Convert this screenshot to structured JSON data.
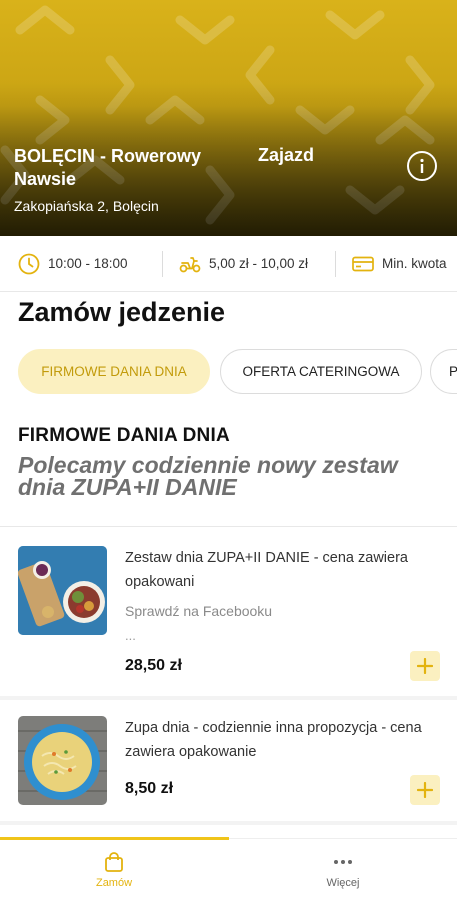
{
  "restaurant": {
    "name": "BOLĘCIN - Rowerowy Nawsie",
    "type": "Zajazd",
    "address": "Zakopiańska 2, Bolęcin"
  },
  "info_bar": {
    "hours": "10:00 - 18:00",
    "delivery_cost": "5,00 zł - 10,00 zł",
    "min_order": "Min. kwota"
  },
  "page_title": "Zamów jedzenie",
  "tabs": [
    {
      "label": "FIRMOWE DANIA DNIA",
      "active": true
    },
    {
      "label": "OFERTA CATERINGOWA",
      "active": false
    },
    {
      "label": "P",
      "active": false
    }
  ],
  "category": {
    "title": "FIRMOWE DANIA DNIA",
    "description": "Polecamy codziennie nowy zestaw dnia ZUPA+II DANIE"
  },
  "items": [
    {
      "name": "Zestaw dnia ZUPA+II DANIE - cena zawiera opakowani",
      "extra": "Sprawdź na Facebooku",
      "ellipsis": "...",
      "price": "28,50 zł"
    },
    {
      "name": "Zupa dnia - codziennie inna propozycja - cena zawiera opakowanie",
      "price": "8,50 zł"
    }
  ],
  "bottom_nav": {
    "order_label": "Zamów",
    "more_label": "Więcej"
  },
  "colors": {
    "accent": "#f0c419",
    "accent_light": "#fbf0c0",
    "accent_text": "#c29b0b"
  }
}
